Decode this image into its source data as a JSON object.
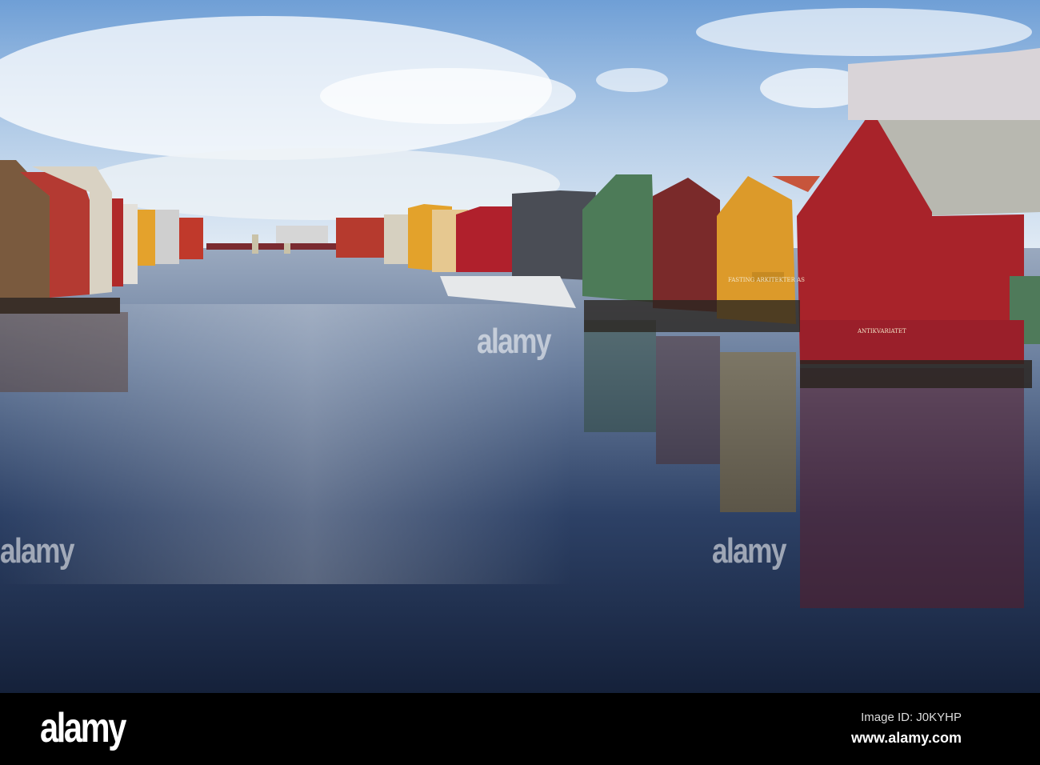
{
  "photo": {
    "signs": [
      "FASTING ARKITEKTER AS",
      "ANTIKVARIATET"
    ],
    "colors": {
      "sky": "#8fb5de",
      "water": "#1c2a45",
      "red_house": "#a8232a",
      "yellow_house": "#dc9a2a",
      "green_house": "#4f7a5a"
    }
  },
  "watermark": {
    "text": "alamy"
  },
  "footer": {
    "logo": "alamy",
    "image_id": "Image ID: J0KYHP",
    "website": "www.alamy.com"
  }
}
